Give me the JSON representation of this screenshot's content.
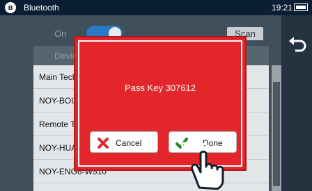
{
  "status_bar": {
    "title": "Bluetooth",
    "time": "19:21"
  },
  "settings": {
    "power_label": "On",
    "scan_label": "Scan",
    "list_header": "Devic"
  },
  "devices": [
    "Main Tech",
    "NOY-BOU",
    "Remote T",
    "NOY-HUA",
    "NOY-ENG6-W510"
  ],
  "dialog": {
    "message": "Pass Key 307612",
    "cancel_label": "Cancel",
    "done_label": "Done"
  },
  "icons": [
    "bluetooth-icon",
    "battery-icon",
    "back-arrow-icon",
    "close-icon",
    "check-icon",
    "pointer-hand-icon"
  ],
  "colors": {
    "dialog_red": "#e2262c",
    "accent_blue": "#2a79c8",
    "check_green": "#1f8a1f"
  }
}
